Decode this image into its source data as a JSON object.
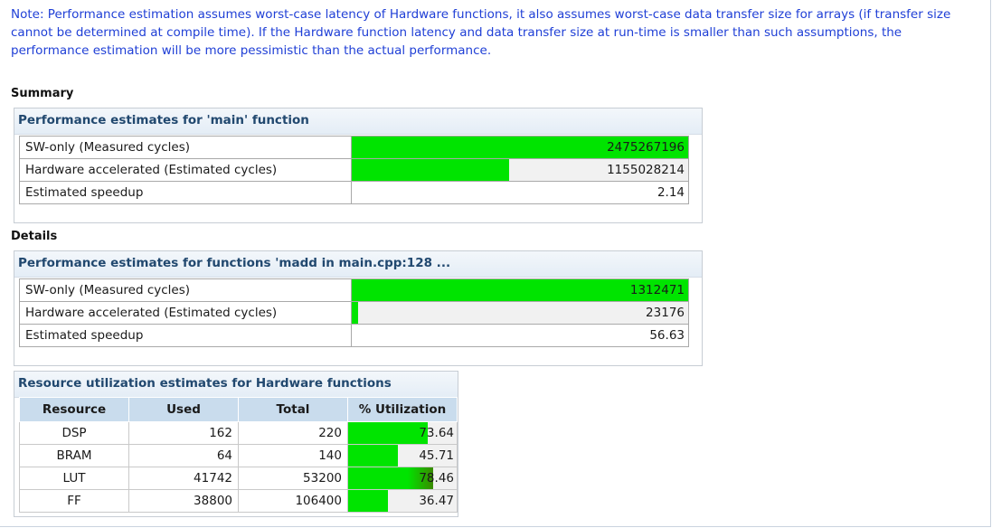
{
  "note": "Note: Performance estimation assumes worst-case latency of Hardware functions, it also assumes worst-case data transfer size for arrays (if transfer size cannot be determined at compile time). If the Hardware function latency and data transfer size at run-time is smaller than such assumptions, the performance estimation will be more pessimistic than the actual performance.",
  "summary": {
    "label": "Summary",
    "panel_title": "Performance estimates for 'main' function",
    "rows": [
      {
        "label": "SW-only (Measured cycles)",
        "value": "2475267196",
        "fill": 1.0
      },
      {
        "label": "Hardware accelerated (Estimated cycles)",
        "value": "1155028214",
        "fill": 0.4667
      },
      {
        "label": "Estimated speedup",
        "value": "2.14"
      }
    ]
  },
  "details": {
    "label": "Details",
    "panel_title": "Performance estimates for functions 'madd in main.cpp:128 ...",
    "rows": [
      {
        "label": "SW-only (Measured cycles)",
        "value": "1312471",
        "fill": 1.0
      },
      {
        "label": "Hardware accelerated (Estimated cycles)",
        "value": "23176",
        "fill": 0.0177
      },
      {
        "label": "Estimated speedup",
        "value": "56.63"
      }
    ]
  },
  "resources": {
    "panel_title": "Resource utilization estimates for Hardware functions",
    "headers": [
      "Resource",
      "Used",
      "Total",
      "% Utilization"
    ],
    "rows": [
      {
        "resource": "DSP",
        "used": "162",
        "total": "220",
        "util": "73.64",
        "fill": 0.7364
      },
      {
        "resource": "BRAM",
        "used": "64",
        "total": "140",
        "util": "45.71",
        "fill": 0.4571
      },
      {
        "resource": "LUT",
        "used": "41742",
        "total": "53200",
        "util": "78.46",
        "fill": 0.7846
      },
      {
        "resource": "FF",
        "used": "38800",
        "total": "106400",
        "util": "36.47",
        "fill": 0.3647
      }
    ]
  },
  "colors": {
    "note_text": "#1f3fd6",
    "bar_green": "#00e400",
    "header_blue": "#21486f"
  }
}
